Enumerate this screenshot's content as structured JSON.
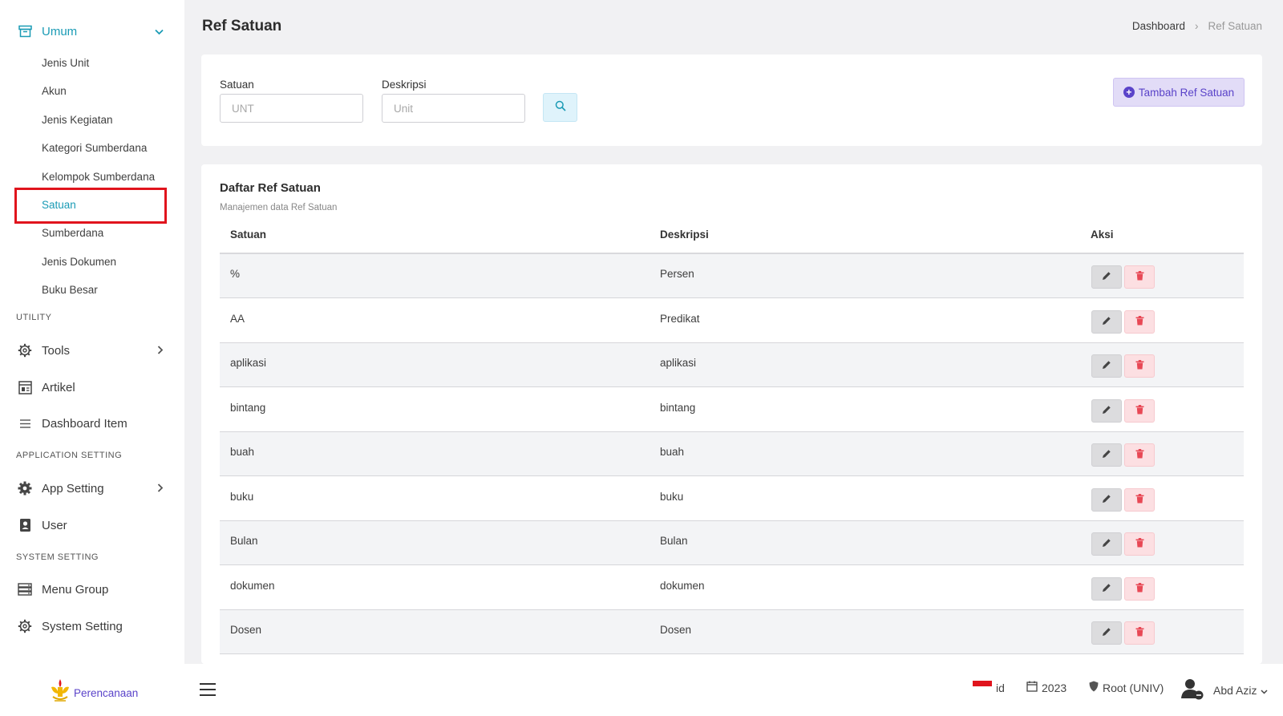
{
  "sidebar": {
    "group_umum": "Umum",
    "sub_items": [
      "Jenis Unit",
      "Akun",
      "Jenis Kegiatan",
      "Kategori Sumberdana",
      "Kelompok Sumberdana",
      "Satuan",
      "Sumberdana",
      "Jenis Dokumen",
      "Buku Besar"
    ],
    "section_utility": "UTILITY",
    "tools": "Tools",
    "artikel": "Artikel",
    "dashboard_item": "Dashboard Item",
    "section_app_setting": "APPLICATION SETTING",
    "app_setting": "App Setting",
    "user": "User",
    "section_system_setting": "SYSTEM SETTING",
    "menu_group": "Menu Group",
    "system_setting": "System Setting"
  },
  "header": {
    "title": "Ref Satuan",
    "breadcrumb_home": "Dashboard",
    "breadcrumb_sep": "›",
    "breadcrumb_current": "Ref Satuan"
  },
  "filter": {
    "satuan_label": "Satuan",
    "satuan_placeholder": "UNT",
    "deskripsi_label": "Deskripsi",
    "deskripsi_placeholder": "Unit",
    "add_button": "Tambah Ref Satuan"
  },
  "table": {
    "title": "Daftar Ref Satuan",
    "subtitle": "Manajemen data Ref Satuan",
    "columns": [
      "Satuan",
      "Deskripsi",
      "Aksi"
    ],
    "rows": [
      {
        "satuan": "%",
        "deskripsi": "Persen"
      },
      {
        "satuan": "AA",
        "deskripsi": "Predikat"
      },
      {
        "satuan": "aplikasi",
        "deskripsi": "aplikasi"
      },
      {
        "satuan": "bintang",
        "deskripsi": "bintang"
      },
      {
        "satuan": "buah",
        "deskripsi": "buah"
      },
      {
        "satuan": "buku",
        "deskripsi": "buku"
      },
      {
        "satuan": "Bulan",
        "deskripsi": "Bulan"
      },
      {
        "satuan": "dokumen",
        "deskripsi": "dokumen"
      },
      {
        "satuan": "Dosen",
        "deskripsi": "Dosen"
      }
    ]
  },
  "bottombar": {
    "brand": "Perencanaan",
    "language": "id",
    "year": "2023",
    "role": "Root (UNIV)",
    "user_name": "Abd Aziz"
  },
  "colors": {
    "accent": "#1a9bb5",
    "primary": "#5a43c9",
    "danger": "#e84855",
    "highlight": "#e0141d"
  }
}
